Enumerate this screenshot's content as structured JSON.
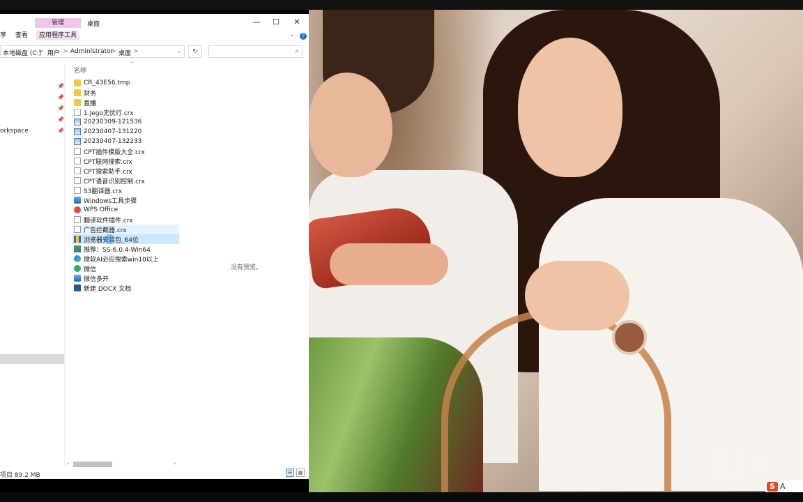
{
  "window": {
    "title": "桌面",
    "ribbon_context_label": "管理",
    "ribbon_tabs": [
      "查看",
      "应用程序工具"
    ],
    "ribbon_left_fragment": "享",
    "controls": {
      "minimize": "—",
      "maximize": "☐",
      "close": "✕"
    },
    "help_label": "?"
  },
  "address": {
    "segments": [
      "本地磁盘 (C:)",
      "用户",
      "Administrator",
      "桌面"
    ],
    "separator": ">",
    "dropdown": "⌄",
    "refresh": "↻",
    "search_placeholder": ""
  },
  "nav": {
    "partial_label": "orkspace"
  },
  "list": {
    "column_name": "名称",
    "files": [
      {
        "name": "CR_43E56.tmp",
        "icon": "folder"
      },
      {
        "name": "财务",
        "icon": "folder"
      },
      {
        "name": "直播",
        "icon": "folder"
      },
      {
        "name": "1.Jego无忧行.crx",
        "icon": "doc"
      },
      {
        "name": "20230309-121536",
        "icon": "img"
      },
      {
        "name": "20230407-131220",
        "icon": "img"
      },
      {
        "name": "20230407-132233",
        "icon": "img"
      },
      {
        "name": "CPT插件模版大全.crx",
        "icon": "doc"
      },
      {
        "name": "CPT联网搜索.crx",
        "icon": "doc"
      },
      {
        "name": "CPT搜索助手.crx",
        "icon": "doc"
      },
      {
        "name": "CPT语音识别控制.crx",
        "icon": "doc"
      },
      {
        "name": "S3翻译器.crx",
        "icon": "doc"
      },
      {
        "name": "Windows工具步骤",
        "icon": "app"
      },
      {
        "name": "WPS Office",
        "icon": "wps"
      },
      {
        "name": "翻译软件插件.crx",
        "icon": "doc"
      },
      {
        "name": "广告拦截器.crx",
        "icon": "doc",
        "state": "hover"
      },
      {
        "name": "浏览器安装包_64位",
        "icon": "zip",
        "state": "selected"
      },
      {
        "name": "推荐：SS-6.0.4-Win64",
        "icon": "setup"
      },
      {
        "name": "微软AI必应搜索win10以上",
        "icon": "edge"
      },
      {
        "name": "微信",
        "icon": "wechat"
      },
      {
        "name": "微信多开",
        "icon": "app"
      },
      {
        "name": "新建 DOCX 文档",
        "icon": "word"
      }
    ]
  },
  "preview_text": "没有预览。",
  "status": {
    "text": "项目 89.2 MB"
  },
  "desktop": {
    "watermark_line1": "激活 Windows",
    "watermark_line2": "转到\"设置\"以激活 Windows。",
    "ime_label": "A"
  },
  "colors": {
    "selection": "#cce8ff",
    "hover": "#e5f3ff",
    "ribbon_context": "#f0c6ec",
    "folder": "#f6c744"
  }
}
